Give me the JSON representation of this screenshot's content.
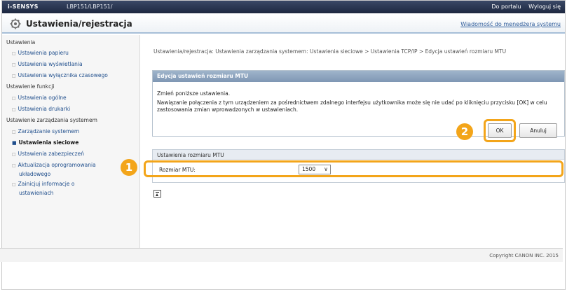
{
  "header": {
    "brand": "i-SENSYS",
    "device": "LBP151/LBP151/",
    "portal_link": "Do portalu",
    "logout_link": "Wyloguj się"
  },
  "title_bar": {
    "title": "Ustawienia/rejestracja",
    "icon": "settings-gear-icon",
    "message_link": "Wiadomość do menedżera systemu"
  },
  "sidebar": {
    "section_1": "Ustawienia",
    "items_1": [
      "Ustawienia papieru",
      "Ustawienia wyświetlania",
      "Ustawienia wyłącznika czasowego"
    ],
    "section_2": "Ustawienie funkcji",
    "items_2": [
      "Ustawienia ogólne",
      "Ustawienia drukarki"
    ],
    "section_3": "Ustawienie zarządzania systemem",
    "items_3": [
      "Zarządzanie systemem",
      "Ustawienia sieciowe",
      "Ustawienia zabezpieczeń",
      "Aktualizacja oprogramowania układowego",
      "Zainicjuj informacje o ustawieniach"
    ],
    "selected": "Ustawienia sieciowe"
  },
  "breadcrumb": "Ustawienia/rejestracja: Ustawienia zarządzania systemem: Ustawienia sieciowe > Ustawienia TCP/IP > Edycja ustawień rozmiaru MTU",
  "panel": {
    "title": "Edycja ustawień rozmiaru MTU",
    "line1": "Zmień poniższe ustawienia.",
    "line2": "Nawiązanie połączenia z tym urządzeniem za pośrednictwem zdalnego interfejsu użytkownika może się nie udać po kliknięciu przycisku [OK] w celu zastosowania zmian wprowadzonych w ustawieniach.",
    "ok": "OK",
    "cancel": "Anuluj"
  },
  "settings": {
    "heading": "Ustawienia rozmiaru MTU",
    "mtu_label": "Rozmiar MTU:",
    "mtu_value": "1500"
  },
  "callouts": {
    "one": "1",
    "two": "2",
    "color": "#f3a51a"
  },
  "footer": {
    "copyright": "Copyright CANON INC. 2015"
  }
}
